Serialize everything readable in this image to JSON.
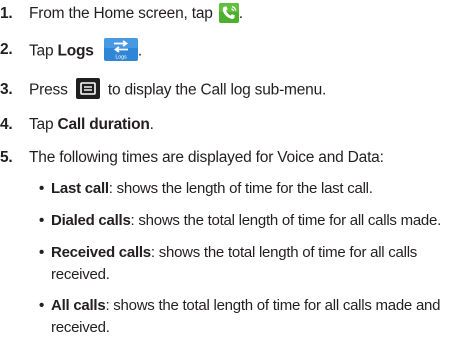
{
  "steps": [
    {
      "number": "1.",
      "text_before": "From the Home screen, tap",
      "icon": "phone-icon",
      "text_after": "."
    },
    {
      "number": "2.",
      "text_before": "Tap ",
      "bold": "Logs",
      "icon": "logs-icon",
      "icon_label": "Logs",
      "text_after": "."
    },
    {
      "number": "3.",
      "text_before": "Press",
      "icon": "menu-icon",
      "text_after": "to display the Call log sub-menu."
    },
    {
      "number": "4.",
      "text_before": "Tap ",
      "bold": "Call duration",
      "text_after": "."
    },
    {
      "number": "5.",
      "text_before": "The following times are displayed for Voice and Data:"
    }
  ],
  "bullets": [
    {
      "bold": "Last call",
      "text": ": shows the length of time for the last call."
    },
    {
      "bold": "Dialed calls",
      "text": ": shows the total length of time for all calls made."
    },
    {
      "bold": "Received calls",
      "text": ": shows the total length of time for all calls received."
    },
    {
      "bold": "All calls",
      "text": ": shows the total length of time for all calls made and received."
    }
  ],
  "bullet_symbol": "•",
  "colors": {
    "text": "#231f20",
    "phone_icon_bg": "#4caf2d",
    "logs_icon_bg": "#2f86d6",
    "menu_icon_bg": "#1f1f1f"
  }
}
